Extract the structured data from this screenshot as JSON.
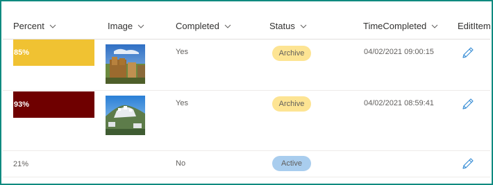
{
  "columns": [
    {
      "label": "Percent"
    },
    {
      "label": "Image"
    },
    {
      "label": "Completed"
    },
    {
      "label": "Status"
    },
    {
      "label": "TimeCompleted"
    },
    {
      "label": "EditItem"
    }
  ],
  "rows": [
    {
      "percent": "85%",
      "percent_value": 0.85,
      "bar_color": "#f0c232",
      "has_image": true,
      "completed": "Yes",
      "status": "Archive",
      "status_color": "#fde493",
      "time": "04/02/2021 09:00:15"
    },
    {
      "percent": "93%",
      "percent_value": 0.93,
      "bar_color": "#6f0000",
      "has_image": true,
      "completed": "Yes",
      "status": "Archive",
      "status_color": "#fde493",
      "time": "04/02/2021 08:59:41"
    },
    {
      "percent": "21%",
      "percent_value": 0.21,
      "bar_color": "",
      "has_image": false,
      "completed": "No",
      "status": "Active",
      "status_color": "#a9cdee",
      "time": ""
    }
  ],
  "colors": {
    "frame_border": "#0f8a80",
    "edit_icon": "#3a8fd6"
  },
  "icons": {
    "sort": "chevron-down-icon",
    "edit": "pencil-icon"
  }
}
